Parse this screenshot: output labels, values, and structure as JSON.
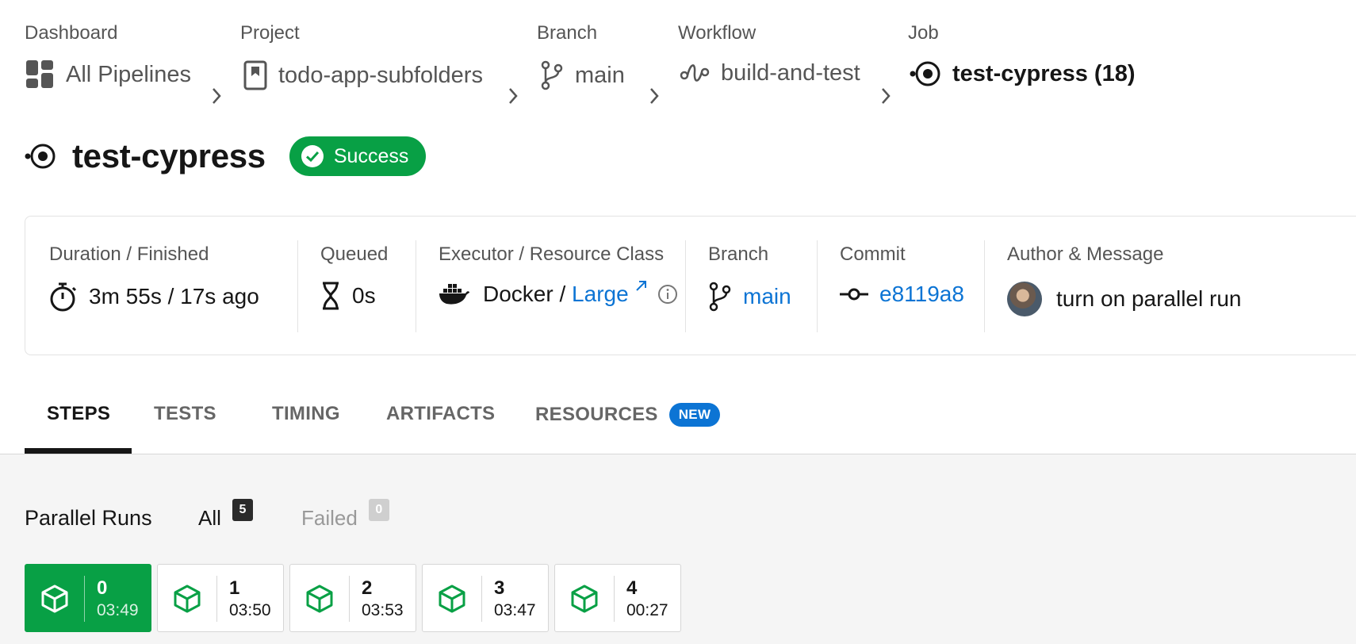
{
  "breadcrumb": [
    {
      "label": "Dashboard",
      "value": "All Pipelines",
      "icon": "dashboard-icon"
    },
    {
      "label": "Project",
      "value": "todo-app-subfolders",
      "icon": "project-bookmark-icon"
    },
    {
      "label": "Branch",
      "value": "main",
      "icon": "branch-icon"
    },
    {
      "label": "Workflow",
      "value": "build-and-test",
      "icon": "workflow-icon"
    },
    {
      "label": "Job",
      "value": "test-cypress (18)",
      "icon": "job-icon"
    }
  ],
  "job": {
    "title": "test-cypress",
    "status": "Success",
    "status_color": "#08a045"
  },
  "info": {
    "duration": {
      "label": "Duration / Finished",
      "value": "3m 55s / 17s ago"
    },
    "queued": {
      "label": "Queued",
      "value": "0s"
    },
    "executor": {
      "label": "Executor / Resource Class",
      "executor": "Docker",
      "separator": " / ",
      "resource_class": "Large"
    },
    "branch": {
      "label": "Branch",
      "value": "main"
    },
    "commit": {
      "label": "Commit",
      "value": "e8119a8"
    },
    "author": {
      "label": "Author & Message",
      "message": "turn on parallel run"
    }
  },
  "tabs": [
    {
      "label": "STEPS",
      "active": true
    },
    {
      "label": "TESTS",
      "active": false
    },
    {
      "label": "TIMING",
      "active": false
    },
    {
      "label": "ARTIFACTS",
      "active": false
    },
    {
      "label": "RESOURCES",
      "active": false,
      "badge": "NEW"
    }
  ],
  "parallel_runs": {
    "title": "Parallel Runs",
    "filters": [
      {
        "label": "All",
        "count": "5"
      },
      {
        "label": "Failed",
        "count": "0"
      }
    ],
    "runs": [
      {
        "index": "0",
        "time": "03:49",
        "selected": true
      },
      {
        "index": "1",
        "time": "03:50",
        "selected": false
      },
      {
        "index": "2",
        "time": "03:53",
        "selected": false
      },
      {
        "index": "3",
        "time": "03:47",
        "selected": false
      },
      {
        "index": "4",
        "time": "00:27",
        "selected": false
      }
    ]
  },
  "colors": {
    "accent": "#0c74d4",
    "success": "#08a045",
    "text": "#161616",
    "muted": "#555555"
  }
}
